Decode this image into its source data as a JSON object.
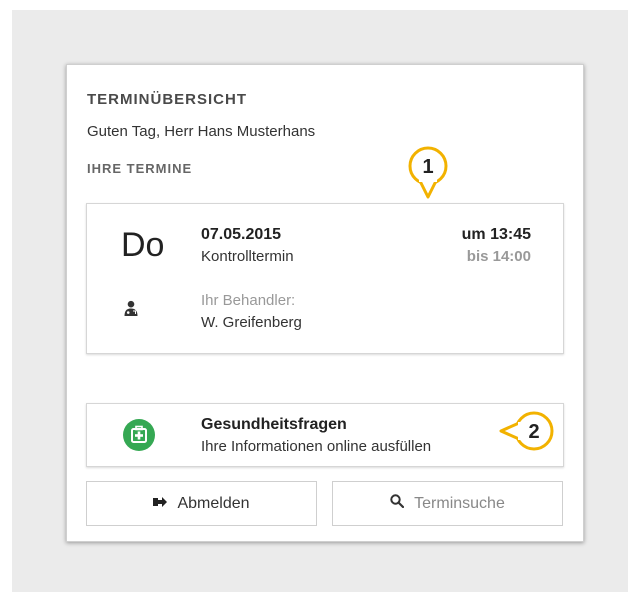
{
  "panel": {
    "title": "TERMINÜBERSICHT",
    "greeting": "Guten Tag, Herr Hans Musterhans",
    "appointments_heading": "IHRE TERMINE"
  },
  "appointment": {
    "weekday": "Do",
    "date": "07.05.2015",
    "type": "Kontrolltermin",
    "time_start": "um 13:45",
    "time_end": "bis 14:00",
    "practitioner_label": "Ihr Behandler:",
    "practitioner_name": "W. Greifenberg",
    "practitioner_icon": "doctor-icon"
  },
  "health": {
    "title": "Gesundheitsfragen",
    "subtitle": "Ihre Informationen online ausfüllen",
    "icon": "medical-kit-icon",
    "icon_color": "#35a853"
  },
  "buttons": {
    "logout_label": "Abmelden",
    "logout_icon": "logout-icon",
    "search_label": "Terminsuche",
    "search_icon": "search-icon"
  },
  "callouts": [
    {
      "number": "1"
    },
    {
      "number": "2"
    }
  ],
  "colors": {
    "callout_stroke": "#f2b200",
    "background": "#ebebeb"
  }
}
